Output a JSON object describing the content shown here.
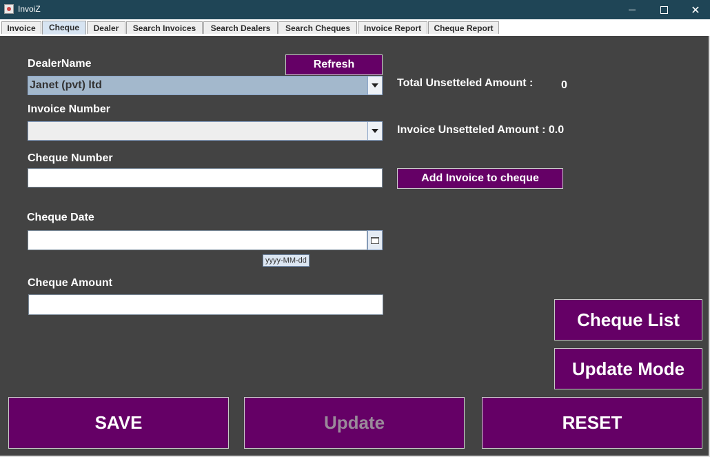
{
  "window": {
    "title": "InvoiZ",
    "close_glyph": "✕"
  },
  "tabs": [
    {
      "label": "Invoice"
    },
    {
      "label": "Cheque"
    },
    {
      "label": "Dealer"
    },
    {
      "label": "Search Invoices"
    },
    {
      "label": "Search Dealers"
    },
    {
      "label": "Search Cheques"
    },
    {
      "label": "Invoice Report"
    },
    {
      "label": "Cheque Report"
    }
  ],
  "form": {
    "dealer_label": "DealerName",
    "dealer_value": "Janet (pvt) ltd",
    "refresh_label": "Refresh",
    "invoice_label": "Invoice Number",
    "invoice_value": "",
    "cheque_number_label": "Cheque Number",
    "cheque_number_value": "",
    "cheque_date_label": "Cheque Date",
    "cheque_date_value": "",
    "date_format_hint": "yyyy-MM-dd",
    "cheque_amount_label": "Cheque Amount",
    "cheque_amount_value": ""
  },
  "summary": {
    "total_label": "Total Unsetteled Amount :",
    "total_value": "0",
    "invoice_label": "Invoice Unsetteled Amount : 0.0",
    "add_invoice_label": "Add Invoice to cheque"
  },
  "actions": {
    "cheque_list": "Cheque List",
    "update_mode": "Update Mode",
    "save": "SAVE",
    "update": "Update",
    "reset": "RESET"
  },
  "colors": {
    "panel_bg": "#434343",
    "button_purple": "#650066",
    "combo_selected": "#a3b8cc",
    "combo_empty": "#eeeeee"
  }
}
